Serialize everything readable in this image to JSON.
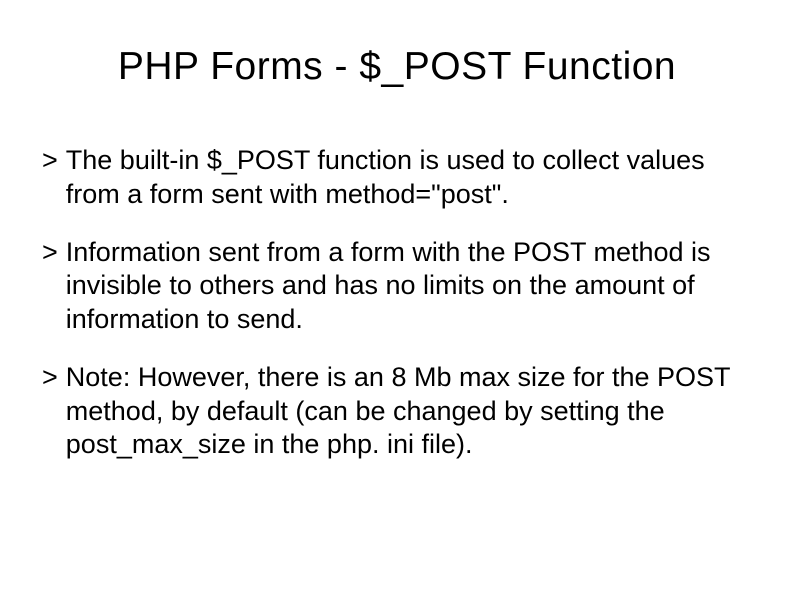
{
  "title": "PHP Forms - $_POST Function",
  "bullets": [
    {
      "marker": ">",
      "text": "The built-in $_POST function is used to collect values from a form sent with method=\"post\"."
    },
    {
      "marker": ">",
      "text": "Information sent from a form with the POST method is invisible to others and has no limits on the amount of information to send."
    },
    {
      "marker": ">",
      "text": "Note: However, there is an 8 Mb max size for the POST method, by default (can be changed by setting the post_max_size in the php. ini file)."
    }
  ]
}
